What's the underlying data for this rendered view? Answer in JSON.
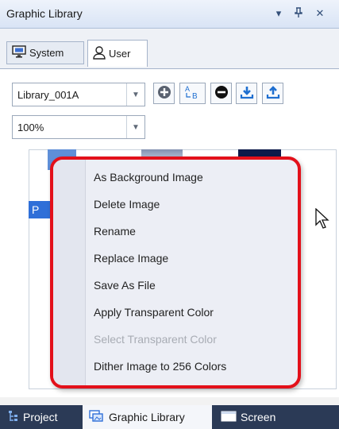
{
  "window": {
    "title": "Graphic Library"
  },
  "title_buttons": {
    "dropdown": "▾",
    "pin": "ᵮ",
    "close": "✕"
  },
  "tabs": [
    {
      "label": "System",
      "icon": "monitor-icon"
    },
    {
      "label": "User",
      "icon": "user-icon"
    }
  ],
  "library_select": {
    "value": "Library_001A"
  },
  "zoom_select": {
    "value": "100%"
  },
  "toolbar": [
    {
      "name": "add-library-button",
      "icon": "plus-circle-icon"
    },
    {
      "name": "rename-library-button",
      "icon": "rename-ab-icon"
    },
    {
      "name": "remove-library-button",
      "icon": "minus-circle-icon"
    },
    {
      "name": "import-button",
      "icon": "download-icon"
    },
    {
      "name": "export-button",
      "icon": "upload-icon"
    }
  ],
  "thumbnail": {
    "label_fragment": "P"
  },
  "context_menu": {
    "items": [
      {
        "label": "As Background Image",
        "enabled": true
      },
      {
        "label": "Delete Image",
        "enabled": true
      },
      {
        "label": "Rename",
        "enabled": true
      },
      {
        "label": "Replace Image",
        "enabled": true
      },
      {
        "label": "Save As File",
        "enabled": true
      },
      {
        "label": "Apply Transparent Color",
        "enabled": true
      },
      {
        "label": "Select Transparent Color",
        "enabled": false
      },
      {
        "label": "Dither Image to 256 Colors",
        "enabled": true
      }
    ]
  },
  "bottom_tabs": [
    {
      "label": "Project",
      "icon": "project-tree-icon",
      "active": false
    },
    {
      "label": "Graphic Library",
      "icon": "graphic-library-icon",
      "active": true
    },
    {
      "label": "Screen",
      "icon": "screen-icon",
      "active": false
    }
  ],
  "colors": {
    "accent": "#e3101a",
    "titlebar": "#dde6f5",
    "bottombar": "#2b3a56"
  }
}
